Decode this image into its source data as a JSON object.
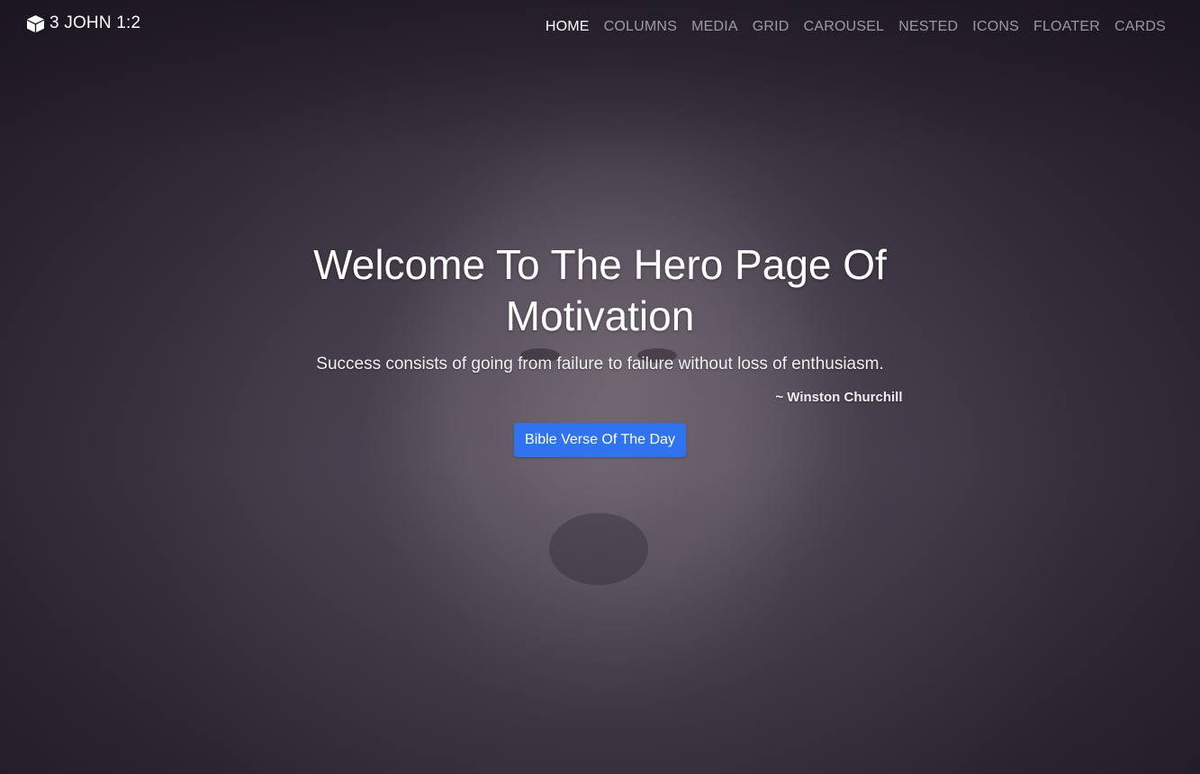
{
  "brand": {
    "icon": "cube-icon",
    "text": "3 JOHN 1:2"
  },
  "nav": {
    "items": [
      {
        "label": "HOME",
        "active": true
      },
      {
        "label": "COLUMNS",
        "active": false
      },
      {
        "label": "MEDIA",
        "active": false
      },
      {
        "label": "GRID",
        "active": false
      },
      {
        "label": "CAROUSEL",
        "active": false
      },
      {
        "label": "NESTED",
        "active": false
      },
      {
        "label": "ICONS",
        "active": false
      },
      {
        "label": "FLOATER",
        "active": false
      },
      {
        "label": "CARDS",
        "active": false
      }
    ]
  },
  "hero": {
    "background": "lion-photo",
    "title": "Welcome To The Hero Page Of Motivation",
    "quote": "Success consists of going from failure to failure without loss of enthusiasm.",
    "author": "~ Winston Churchill",
    "button_label": "Bible Verse Of The Day"
  },
  "colors": {
    "accent": "#2f73f1",
    "text": "#ffffff"
  }
}
